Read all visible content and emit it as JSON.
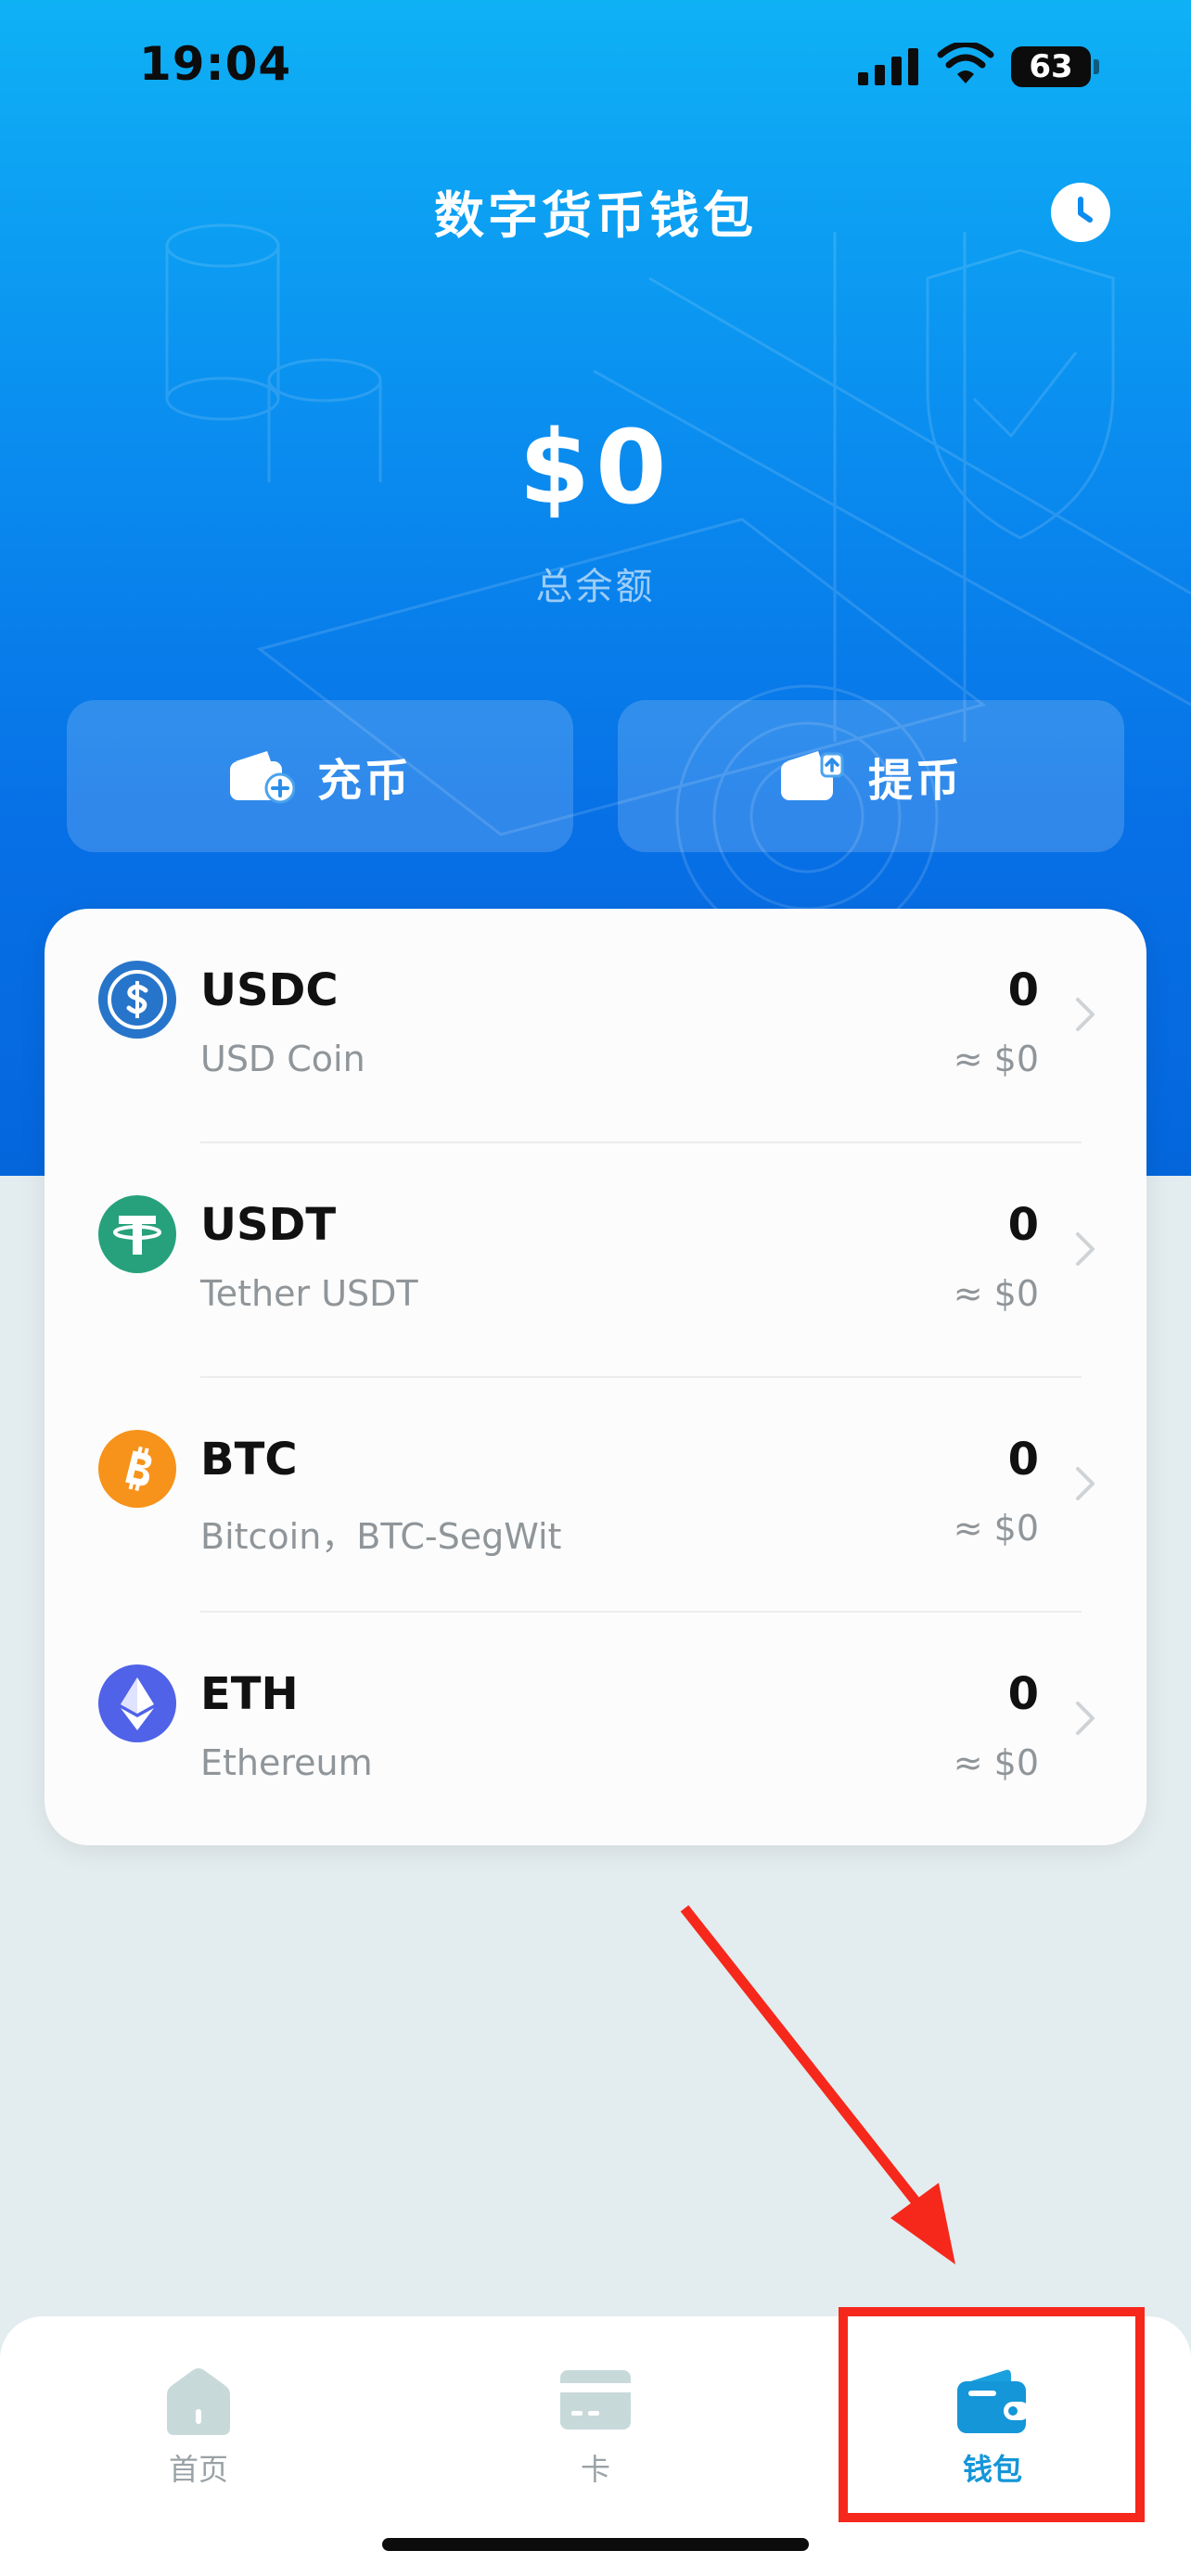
{
  "status": {
    "time": "19:04",
    "battery": "63"
  },
  "header": {
    "title": "数字货币钱包",
    "history_icon": "clock-icon"
  },
  "balance": {
    "amount": "$0",
    "label": "总余额"
  },
  "actions": {
    "deposit": "充币",
    "withdraw": "提币"
  },
  "assets": [
    {
      "symbol": "USDC",
      "name": "USD Coin",
      "amount": "0",
      "usd": "≈ $0",
      "color": "#2775ca",
      "icon": "usdc-icon"
    },
    {
      "symbol": "USDT",
      "name": "Tether USDT",
      "amount": "0",
      "usd": "≈ $0",
      "color": "#26a17b",
      "icon": "usdt-icon"
    },
    {
      "symbol": "BTC",
      "name": "Bitcoin，BTC-SegWit",
      "amount": "0",
      "usd": "≈ $0",
      "color": "#f7931a",
      "icon": "btc-icon"
    },
    {
      "symbol": "ETH",
      "name": "Ethereum",
      "amount": "0",
      "usd": "≈ $0",
      "color": "#4f62e8",
      "icon": "eth-icon"
    }
  ],
  "tabs": [
    {
      "label": "首页",
      "icon": "home-icon",
      "active": false
    },
    {
      "label": "卡",
      "icon": "card-icon",
      "active": false
    },
    {
      "label": "钱包",
      "icon": "wallet-icon",
      "active": true
    }
  ],
  "colors": {
    "accent": "#0b8ef0",
    "tab_active": "#1496d8",
    "annotation": "#f5281b"
  }
}
